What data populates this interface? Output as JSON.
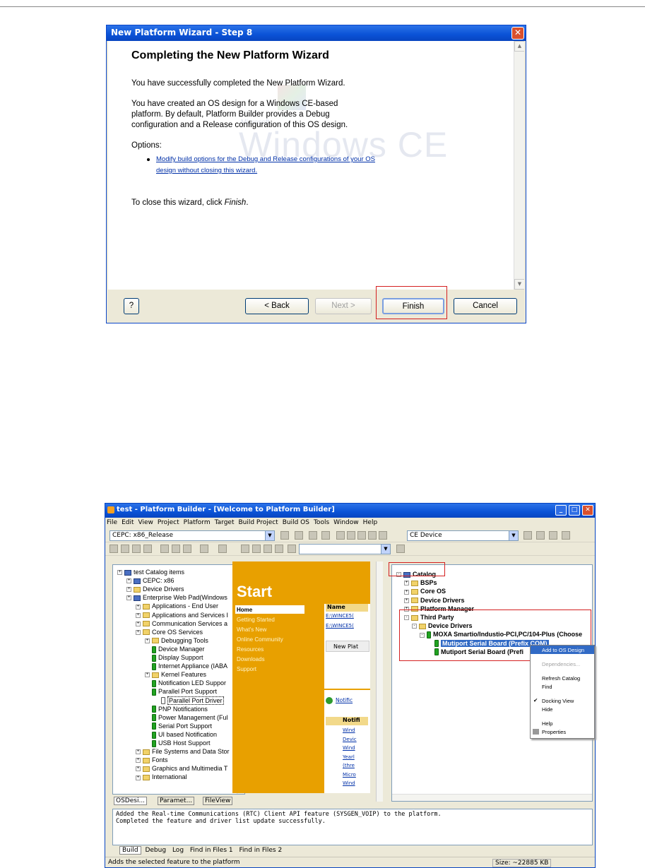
{
  "wizard": {
    "title": "New Platform Wizard - Step 8",
    "heading": "Completing the New Platform Wizard",
    "para1": "You have successfully completed the New Platform Wizard.",
    "para2_l1": "You have created an OS design for a Windows CE-based",
    "para2_l2": "platform. By default, Platform Builder provides a Debug",
    "para2_l3": "configuration and a Release configuration of this OS design.",
    "options_label": "Options:",
    "option_link_l1": "Modify build options for the Debug and Release configurations of your OS",
    "option_link_l2": "design without closing this wizard.",
    "close_text": "To close this wizard, click ",
    "close_emph": "Finish",
    "close_end": ".",
    "watermark_small": "Microsoft",
    "watermark_big": "Windows CE",
    "buttons": {
      "help": "?",
      "back": "< Back",
      "next": "Next >",
      "finish": "Finish",
      "cancel": "Cancel"
    }
  },
  "pb": {
    "title": "test - Platform Builder - [Welcome to Platform Builder]",
    "menu": [
      "File",
      "Edit",
      "View",
      "Project",
      "Platform",
      "Target",
      "Build Project",
      "Build OS",
      "Tools",
      "Window",
      "Help"
    ],
    "config_combo": "CEPC: x86_Release",
    "device_combo": "CE Device",
    "left_tree": [
      {
        "label": "test Catalog items",
        "level": 0,
        "icon": "catalog"
      },
      {
        "label": "CEPC: x86",
        "level": 1,
        "icon": "bsp"
      },
      {
        "label": "Device Drivers",
        "level": 1,
        "icon": "folder"
      },
      {
        "label": "Enterprise Web Pad(Windows",
        "level": 1,
        "icon": "bsp"
      },
      {
        "label": "Applications - End User",
        "level": 2,
        "icon": "folder"
      },
      {
        "label": "Applications and Services I",
        "level": 2,
        "icon": "folder"
      },
      {
        "label": "Communication Services a",
        "level": 2,
        "icon": "folder"
      },
      {
        "label": "Core OS Services",
        "level": 2,
        "icon": "folder"
      },
      {
        "label": "Debugging Tools",
        "level": 3,
        "icon": "folder"
      },
      {
        "label": "Device Manager",
        "level": 3,
        "icon": "comp"
      },
      {
        "label": "Display Support",
        "level": 3,
        "icon": "comp"
      },
      {
        "label": "Internet Appliance (IABA",
        "level": 3,
        "icon": "comp"
      },
      {
        "label": "Kernel Features",
        "level": 3,
        "icon": "folder"
      },
      {
        "label": "Notification LED Suppor",
        "level": 3,
        "icon": "comp"
      },
      {
        "label": "Parallel Port Support",
        "level": 3,
        "icon": "comp"
      },
      {
        "label": "Parallel Port Driver",
        "level": 4,
        "icon": "doc"
      },
      {
        "label": "PNP Notifications",
        "level": 3,
        "icon": "comp"
      },
      {
        "label": "Power Management (Ful",
        "level": 3,
        "icon": "comp"
      },
      {
        "label": "Serial Port Support",
        "level": 3,
        "icon": "comp"
      },
      {
        "label": "UI based Notification",
        "level": 3,
        "icon": "comp"
      },
      {
        "label": "USB Host Support",
        "level": 3,
        "icon": "comp"
      },
      {
        "label": "File Systems and Data Stor",
        "level": 2,
        "icon": "folder"
      },
      {
        "label": "Fonts",
        "level": 2,
        "icon": "folder"
      },
      {
        "label": "Graphics and Multimedia T",
        "level": 2,
        "icon": "folder"
      },
      {
        "label": "International",
        "level": 2,
        "icon": "folder"
      }
    ],
    "left_tabs": [
      "OSDesi...",
      "Paramet...",
      "FileView"
    ],
    "start": {
      "title": "Start",
      "nav": [
        "Home",
        "Getting Started",
        "What's New",
        "Online Community",
        "Resources",
        "Downloads",
        "Support"
      ],
      "name_header": "Name",
      "name_rows": [
        "E:\\WINCE5(",
        "E:\\WINCE5("
      ],
      "new_button": "New Plat",
      "notif_link": "Notific",
      "notif_header": "Notifi",
      "notif_rows": [
        "Wind",
        "Devic",
        "Wind",
        "Yearl",
        "(thre",
        "Micro",
        "Wind"
      ]
    },
    "catalog_tree": [
      {
        "label": "Catalog",
        "level": 0,
        "icon": "catalog",
        "exp": "-"
      },
      {
        "label": "BSPs",
        "level": 1,
        "icon": "folder",
        "exp": "+"
      },
      {
        "label": "Core OS",
        "level": 1,
        "icon": "folder",
        "exp": "+"
      },
      {
        "label": "Device Drivers",
        "level": 1,
        "icon": "folder",
        "exp": "+"
      },
      {
        "label": "Platform Manager",
        "level": 1,
        "icon": "folder",
        "exp": "+"
      },
      {
        "label": "Third Party",
        "level": 1,
        "icon": "folder",
        "exp": "-"
      },
      {
        "label": "Device Drivers",
        "level": 2,
        "icon": "folder",
        "exp": "-"
      },
      {
        "label": "MOXA Smartio/Industio-PCI,PC/104-Plus (Choose",
        "level": 3,
        "icon": "comp",
        "exp": "-"
      },
      {
        "label": "Mutiport Serial Board (Prefix COM)",
        "level": 4,
        "icon": "comp",
        "exp": "",
        "selected": true
      },
      {
        "label": "Mutiport Serial Board (Prefi",
        "level": 4,
        "icon": "comp",
        "exp": ""
      }
    ],
    "context_menu": [
      "Add to OS Design",
      "Dependencies...",
      "Refresh Catalog",
      "Find",
      "Docking View",
      "Hide",
      "Help",
      "Properties"
    ],
    "output_lines": [
      "Added the Real-time Communications (RTC) Client API feature (SYSGEN_VOIP) to the platform.",
      "Completed the feature and driver list update successfully."
    ],
    "output_tabs": [
      "Build",
      "Debug",
      "Log",
      "Find in Files 1",
      "Find in Files 2"
    ],
    "status_text": "Adds the selected feature to the platform",
    "status_size": "Size: ~22885 KB"
  }
}
